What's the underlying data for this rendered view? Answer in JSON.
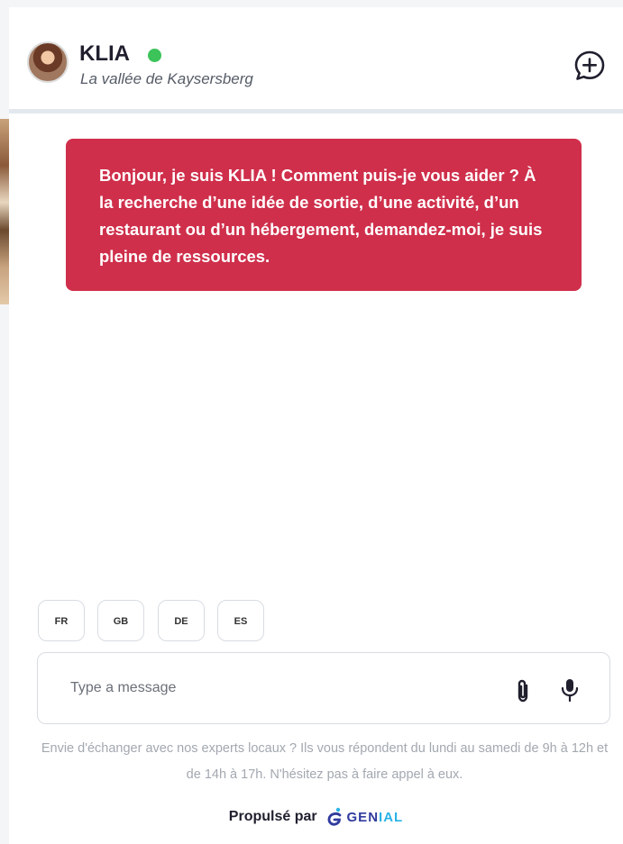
{
  "header": {
    "name": "KLIA",
    "subtitle": "La vallée de Kaysersberg",
    "status": "online",
    "status_color": "#3cc35a",
    "new_chat_icon": "chat-plus-icon"
  },
  "message": {
    "text": "Bonjour, je suis KLIA ! Comment puis-je vous aider ? À la recherche d’une idée de sortie, d’une activité, d’un restaurant ou d’un hébergement, demandez-moi, je suis pleine de ressources.",
    "bubble_color": "#cf2f4b"
  },
  "languages": [
    "FR",
    "GB",
    "DE",
    "ES"
  ],
  "composer": {
    "placeholder": "Type a message",
    "attach_icon": "paperclip-icon",
    "mic_icon": "microphone-icon"
  },
  "info_text": "Envie d'échanger avec nos experts locaux ? Ils vous répondent du lundi au samedi de 9h à 12h et de 14h à 17h. N'hésitez pas à faire appel à eux.",
  "footer": {
    "powered_label": "Propulsé par",
    "brand_main": "GEN",
    "brand_accent": "IAL"
  }
}
